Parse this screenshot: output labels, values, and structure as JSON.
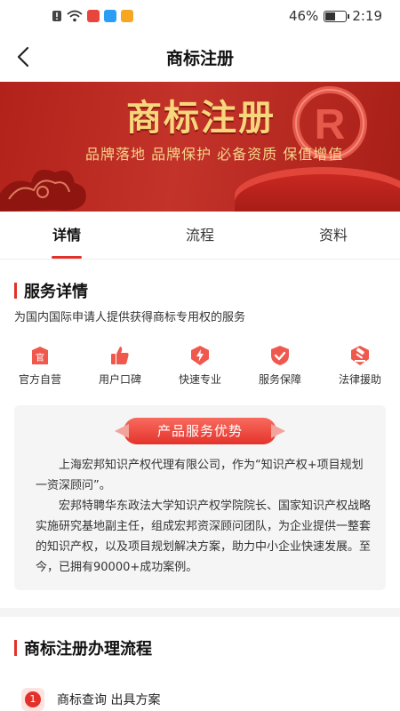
{
  "status_bar": {
    "battery_text": "46%",
    "battery_level": 0.46,
    "time": "2:19",
    "icons": [
      "alert-icon",
      "wifi-icon",
      "app-icon-red",
      "search-app-icon",
      "video-app-icon"
    ]
  },
  "nav": {
    "title": "商标注册",
    "back_icon": "chevron-left-icon"
  },
  "banner": {
    "title": "商标注册",
    "subtitle": "品牌落地 品牌保护 必备资质 保值增值",
    "mark": "R"
  },
  "tabs": [
    {
      "label": "详情",
      "active": true
    },
    {
      "label": "流程",
      "active": false
    },
    {
      "label": "资料",
      "active": false
    }
  ],
  "detail": {
    "title": "服务详情",
    "description": "为国内国际申请人提供获得商标专用权的服务"
  },
  "features": [
    {
      "label": "官方自营",
      "icon": "official-icon",
      "icon_text": "官"
    },
    {
      "label": "用户口碑",
      "icon": "thumbs-up-icon"
    },
    {
      "label": "快速专业",
      "icon": "lightning-icon"
    },
    {
      "label": "服务保障",
      "icon": "shield-check-icon"
    },
    {
      "label": "法律援助",
      "icon": "gavel-icon"
    }
  ],
  "advantages": {
    "title": "产品服务优势",
    "paragraph1": "上海宏邦知识产权代理有限公司，作为“知识产权+项目规划一资深顾问”。",
    "paragraph2": "宏邦特聘华东政法大学知识产权学院院长、国家知识产权战略实施研究基地副主任，组成宏邦资深顾问团队，为企业提供一整套的知识产权，以及项目规划解决方案，助力中小企业快速发展。至今，已拥有90000+成功案例。"
  },
  "process": {
    "title": "商标注册办理流程",
    "steps": [
      {
        "number": "1",
        "label": "商标查询 出具方案"
      }
    ]
  },
  "colors": {
    "accent": "#e2312a",
    "banner_red": "#b2221a",
    "gold": "#f7d67c"
  }
}
